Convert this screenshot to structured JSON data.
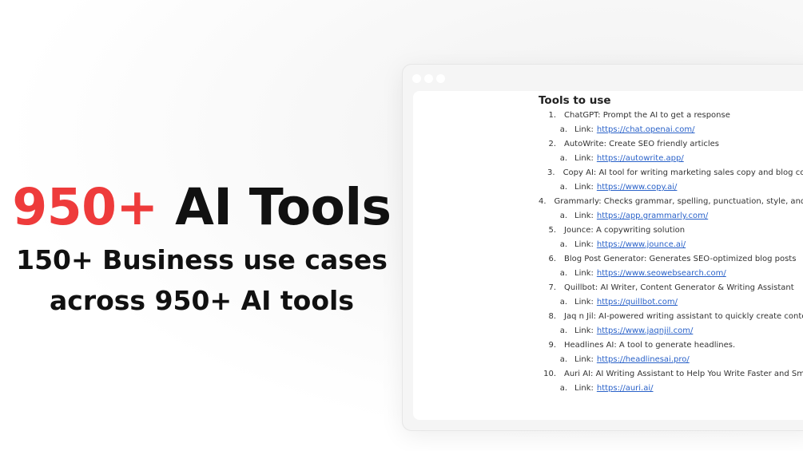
{
  "hero": {
    "title_accent": "950+",
    "title_rest": "AI Tools",
    "subtitle_line1": "150+ Business use cases",
    "subtitle_line2": "across 950+ AI tools"
  },
  "document": {
    "heading": "Tools to use",
    "link_marker": "a.",
    "link_label": "Link:",
    "tools": [
      {
        "num": "1.",
        "text": "ChatGPT: Prompt the AI to get a response",
        "url": "https://chat.openai.com/"
      },
      {
        "num": "2.",
        "text": "AutoWrite: Create SEO friendly articles",
        "url": "https://autowrite.app/"
      },
      {
        "num": "3.",
        "text": "Copy AI: AI tool for writing marketing sales copy and blog content",
        "url": "https://www.copy.ai/"
      },
      {
        "num": "4.",
        "text": "Grammarly: Checks grammar, spelling, punctuation, style, and plagiarism",
        "url": "https://app.grammarly.com/"
      },
      {
        "num": "5.",
        "text": "Jounce: A copywriting solution",
        "url": "https://www.jounce.ai/"
      },
      {
        "num": "6.",
        "text": "Blog Post Generator: Generates SEO-optimized blog posts",
        "url": "https://www.seowebsearch.com/"
      },
      {
        "num": "7.",
        "text": "Quillbot: AI Writer, Content Generator & Writing Assistant",
        "url": "https://quillbot.com/"
      },
      {
        "num": "8.",
        "text": "Jaq n Jil: AI-powered writing assistant to quickly create content",
        "url": "https://www.jaqnjil.com/"
      },
      {
        "num": "9.",
        "text": "Headlines AI: A tool to generate headlines.",
        "url": "https://headlinesai.pro/"
      },
      {
        "num": "10.",
        "text": "Auri AI: AI Writing Assistant to Help You Write Faster and Smarter",
        "url": "https://auri.ai/"
      }
    ]
  }
}
